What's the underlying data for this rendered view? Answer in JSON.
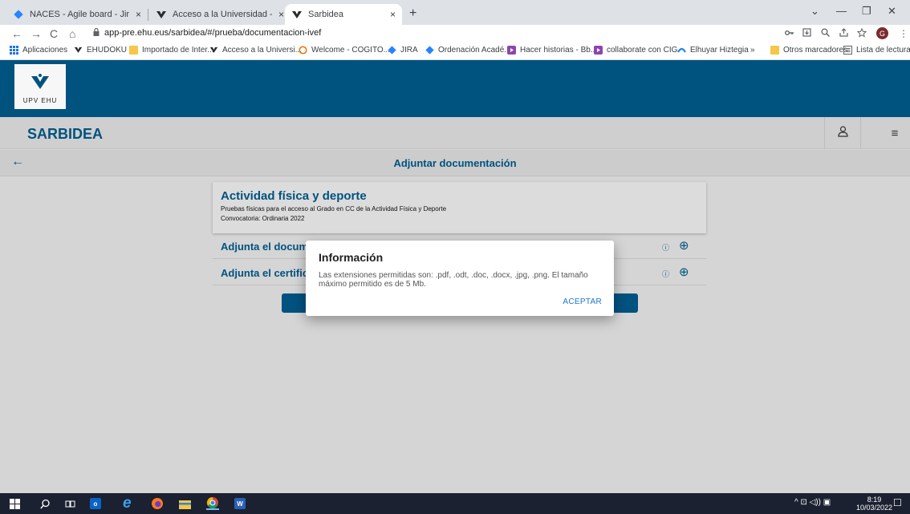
{
  "browser": {
    "tabs": [
      {
        "title": "NACES - Agile board - Jira",
        "close": "×"
      },
      {
        "title": "Acceso a la Universidad - UPV/EHU",
        "close": "×"
      },
      {
        "title": "Sarbidea",
        "close": "×"
      }
    ],
    "new_tab": "+",
    "window_controls": {
      "chevron": "⌄",
      "minimize": "—",
      "restore": "❐",
      "close": "✕"
    },
    "nav": {
      "back": "←",
      "forward": "→",
      "reload": "C",
      "home": "⌂"
    },
    "url": "app-pre.ehu.eus/sarbidea/#/prueba/documentacion-ivef",
    "profile_initial": "G",
    "menu_dots": "⋮"
  },
  "bookmarks": [
    "Aplicaciones",
    "EHUDOKU",
    "Importado de Inter...",
    "Acceso a la Universi...",
    "Welcome - COGITO...",
    "JIRA",
    "Ordenación Acadé...",
    "Hacer historias - Bb...",
    "collaborate con CIG",
    "Elhuyar Hiztegia"
  ],
  "bookmarks_more": "»",
  "bookmarks_other": "Otros marcadores",
  "bookmarks_reading": "Lista de lectura",
  "app": {
    "logo_text": "UPV  EHU",
    "title": "SARBIDEA",
    "page_title": "Adjuntar documentación",
    "back_icon": "←",
    "user_icon": "♙",
    "menu_icon": "≡"
  },
  "card": {
    "title": "Actividad física y deporte",
    "subtitle": "Pruebas físicas para el acceso al Grado en CC de la Actividad Física y Deporte",
    "convocatoria": "Convocatoria: Ordinaria 2022"
  },
  "rows": [
    {
      "label": "Adjunta el docum",
      "info": "ⓘ",
      "add": "⊕"
    },
    {
      "label": "Adjunta el certific",
      "info": "ⓘ",
      "add": "⊕"
    }
  ],
  "dialog": {
    "title": "Información",
    "body": "Las extensiones permitidas son: .pdf, .odt, .doc, .docx, .jpg, .png. El tamaño máximo permitido es de 5 Mb.",
    "button": "ACEPTAR"
  },
  "taskbar": {
    "start": "⊞",
    "search": "⚲",
    "taskview": "⧉",
    "outlook": "o",
    "edge": "e",
    "firefox": "●",
    "explorer": "▬",
    "chrome": "◉",
    "word": "W",
    "tray": "^ ⊡ ◁)) ▣",
    "time": "8:19",
    "date": "10/03/2022",
    "notifications": "☐"
  },
  "colors": {
    "brand": "#005584",
    "dialog_button": "#1976d2"
  }
}
